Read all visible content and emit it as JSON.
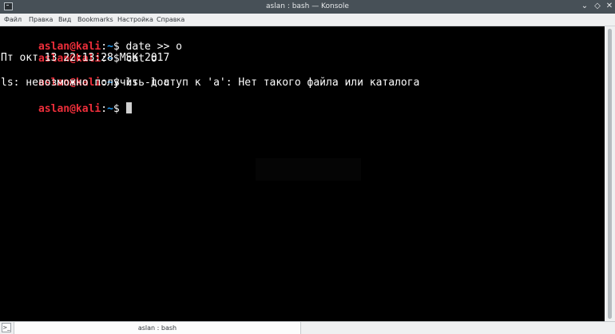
{
  "window": {
    "title": "aslan : bash — Konsole",
    "controls": {
      "minimize": "⌄",
      "maximize": "◇",
      "close": "✕"
    }
  },
  "menubar": {
    "items": [
      "Файл",
      "Правка",
      "Вид",
      "Bookmarks",
      "Настройка",
      "Справка"
    ]
  },
  "terminal": {
    "prompt_user": "aslan@kali",
    "prompt_sep": ":",
    "prompt_path": "~",
    "prompt_symbol": "$",
    "lines": [
      {
        "type": "prompt",
        "command": " date >> o"
      },
      {
        "type": "prompt",
        "command": " cat o"
      },
      {
        "type": "output",
        "text": "Пт окт 13 22:13:28 MSK 2017"
      },
      {
        "type": "prompt",
        "command": " ls -l a"
      },
      {
        "type": "output",
        "text": "ls: невозможно получить доступ к 'a': Нет такого файла или каталога"
      },
      {
        "type": "prompt",
        "command": " "
      }
    ]
  },
  "tabs": {
    "new_tab_icon": "terminal-icon",
    "items": [
      {
        "label": "aslan : bash"
      }
    ]
  },
  "colors": {
    "user_prompt": "#ed2e3a",
    "path": "#1d99f3",
    "text": "#fcfcfc",
    "background": "#000000",
    "titlebar": "#475057"
  }
}
